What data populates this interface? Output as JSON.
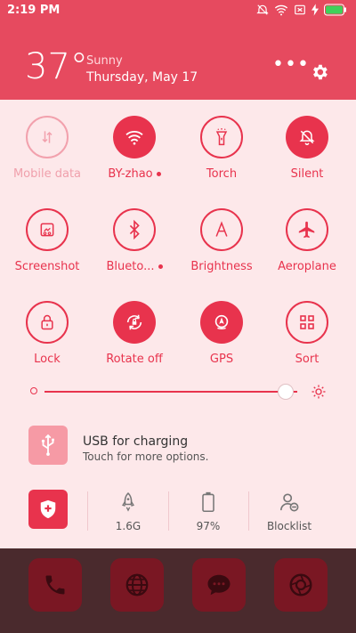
{
  "status_bar": {
    "time": "2:19 PM"
  },
  "header": {
    "temperature": "37°",
    "weather": "Sunny",
    "date": "Thursday, May 17",
    "more_label": "•••"
  },
  "tiles": [
    {
      "label": "Mobile data",
      "state": "disabled",
      "icon": "data-arrows-icon"
    },
    {
      "label": "BY-zhao",
      "state": "on",
      "icon": "wifi-icon",
      "dot": true
    },
    {
      "label": "Torch",
      "state": "off",
      "icon": "torch-icon"
    },
    {
      "label": "Silent",
      "state": "on",
      "icon": "bell-off-icon"
    },
    {
      "label": "Screenshot",
      "state": "off",
      "icon": "screenshot-icon"
    },
    {
      "label": "Blueto...",
      "state": "off",
      "icon": "bluetooth-icon",
      "dot": true
    },
    {
      "label": "Brightness",
      "state": "off",
      "icon": "brightness-a-icon"
    },
    {
      "label": "Aeroplane",
      "state": "off",
      "icon": "airplane-icon"
    },
    {
      "label": "Lock",
      "state": "off",
      "icon": "lock-icon"
    },
    {
      "label": "Rotate off",
      "state": "on",
      "icon": "rotate-lock-icon"
    },
    {
      "label": "GPS",
      "state": "on",
      "icon": "gps-icon"
    },
    {
      "label": "Sort",
      "state": "off",
      "icon": "grid-icon"
    }
  ],
  "brightness": {
    "level": 0.95
  },
  "notification": {
    "title": "USB for charging",
    "subtitle": "Touch for more options."
  },
  "stats": {
    "memory": "1.6G",
    "battery": "97%",
    "blocklist": "Blocklist"
  },
  "colors": {
    "accent": "#e8334d",
    "header": "#e64a5f",
    "panel": "#fde8ea"
  }
}
